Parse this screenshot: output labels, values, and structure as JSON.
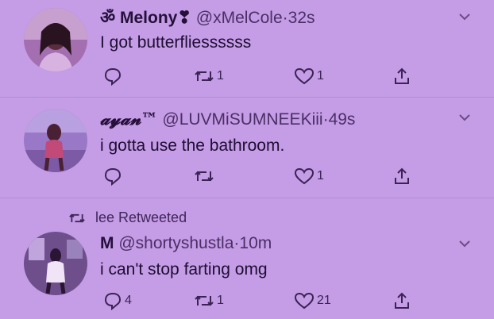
{
  "tweets": [
    {
      "name": "ॐ Melony❣",
      "handle": "@xMelCole",
      "time": "32s",
      "text": "I got butterfliessssss",
      "replies": "",
      "retweets": "1",
      "likes": "1"
    },
    {
      "name": "𝓪𝔂𝓪𝓷™",
      "handle": "@LUVMiSUMNEEKiii",
      "time": "49s",
      "text": "i gotta use the bathroom.",
      "replies": "",
      "retweets": "",
      "likes": "1"
    },
    {
      "retweet_context": "lee Retweeted",
      "name": "M",
      "handle": "@shortyshustla",
      "time": "10m",
      "text": "i can't stop farting omg",
      "replies": "4",
      "retweets": "1",
      "likes": "21"
    }
  ],
  "separator": "·",
  "colors": {
    "background": "#c59ce6",
    "text": "#24103a",
    "icon": "#3b2355"
  }
}
